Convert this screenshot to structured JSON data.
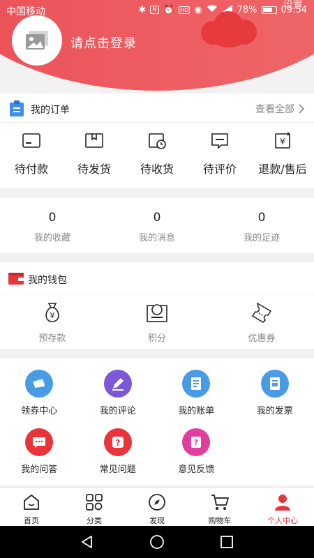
{
  "status_bar": {
    "carrier": "中国移动",
    "battery": "78%",
    "time": "09:54",
    "settings_peek": "设置"
  },
  "profile": {
    "login_prompt": "请点击登录",
    "avatar_icon": "image-placeholder-icon"
  },
  "orders": {
    "title": "我的订单",
    "view_all": "查看全部",
    "items": [
      {
        "label": "待付款",
        "icon": "card-icon"
      },
      {
        "label": "待发货",
        "icon": "box-icon"
      },
      {
        "label": "待收货",
        "icon": "clock-box-icon"
      },
      {
        "label": "待评价",
        "icon": "comment-icon"
      },
      {
        "label": "退款/售后",
        "icon": "refund-icon"
      }
    ]
  },
  "stats": [
    {
      "value": "0",
      "label": "我的收藏"
    },
    {
      "value": "0",
      "label": "我的消息"
    },
    {
      "value": "0",
      "label": "我的足迹"
    }
  ],
  "wallet": {
    "title": "我的钱包",
    "items": [
      {
        "label": "预存款",
        "icon": "money-bag-icon"
      },
      {
        "label": "积分",
        "icon": "points-icon"
      },
      {
        "label": "优惠券",
        "icon": "ticket-icon"
      }
    ]
  },
  "services": [
    {
      "label": "领券中心",
      "icon": "coupon-center-icon",
      "color": "#4a9be6"
    },
    {
      "label": "我的评论",
      "icon": "pen-icon",
      "color": "#7c57d6"
    },
    {
      "label": "我的账单",
      "icon": "bill-icon",
      "color": "#4a9be6"
    },
    {
      "label": "我的发票",
      "icon": "invoice-icon",
      "color": "#4a9be6"
    },
    {
      "label": "我的问答",
      "icon": "chat-icon",
      "color": "#e8343a"
    },
    {
      "label": "常见问题",
      "icon": "question-icon",
      "color": "#e8343a"
    },
    {
      "label": "意见反馈",
      "icon": "feedback-icon",
      "color": "#e03fa0"
    }
  ],
  "tabbar": [
    {
      "label": "首页",
      "icon": "home-icon"
    },
    {
      "label": "分类",
      "icon": "category-icon"
    },
    {
      "label": "发现",
      "icon": "compass-icon"
    },
    {
      "label": "购物车",
      "icon": "cart-icon"
    },
    {
      "label": "个人中心",
      "icon": "user-icon",
      "active": true
    }
  ],
  "colors": {
    "brand": "#ea4f57",
    "accent": "#e8343a",
    "muted_text": "#888888"
  }
}
